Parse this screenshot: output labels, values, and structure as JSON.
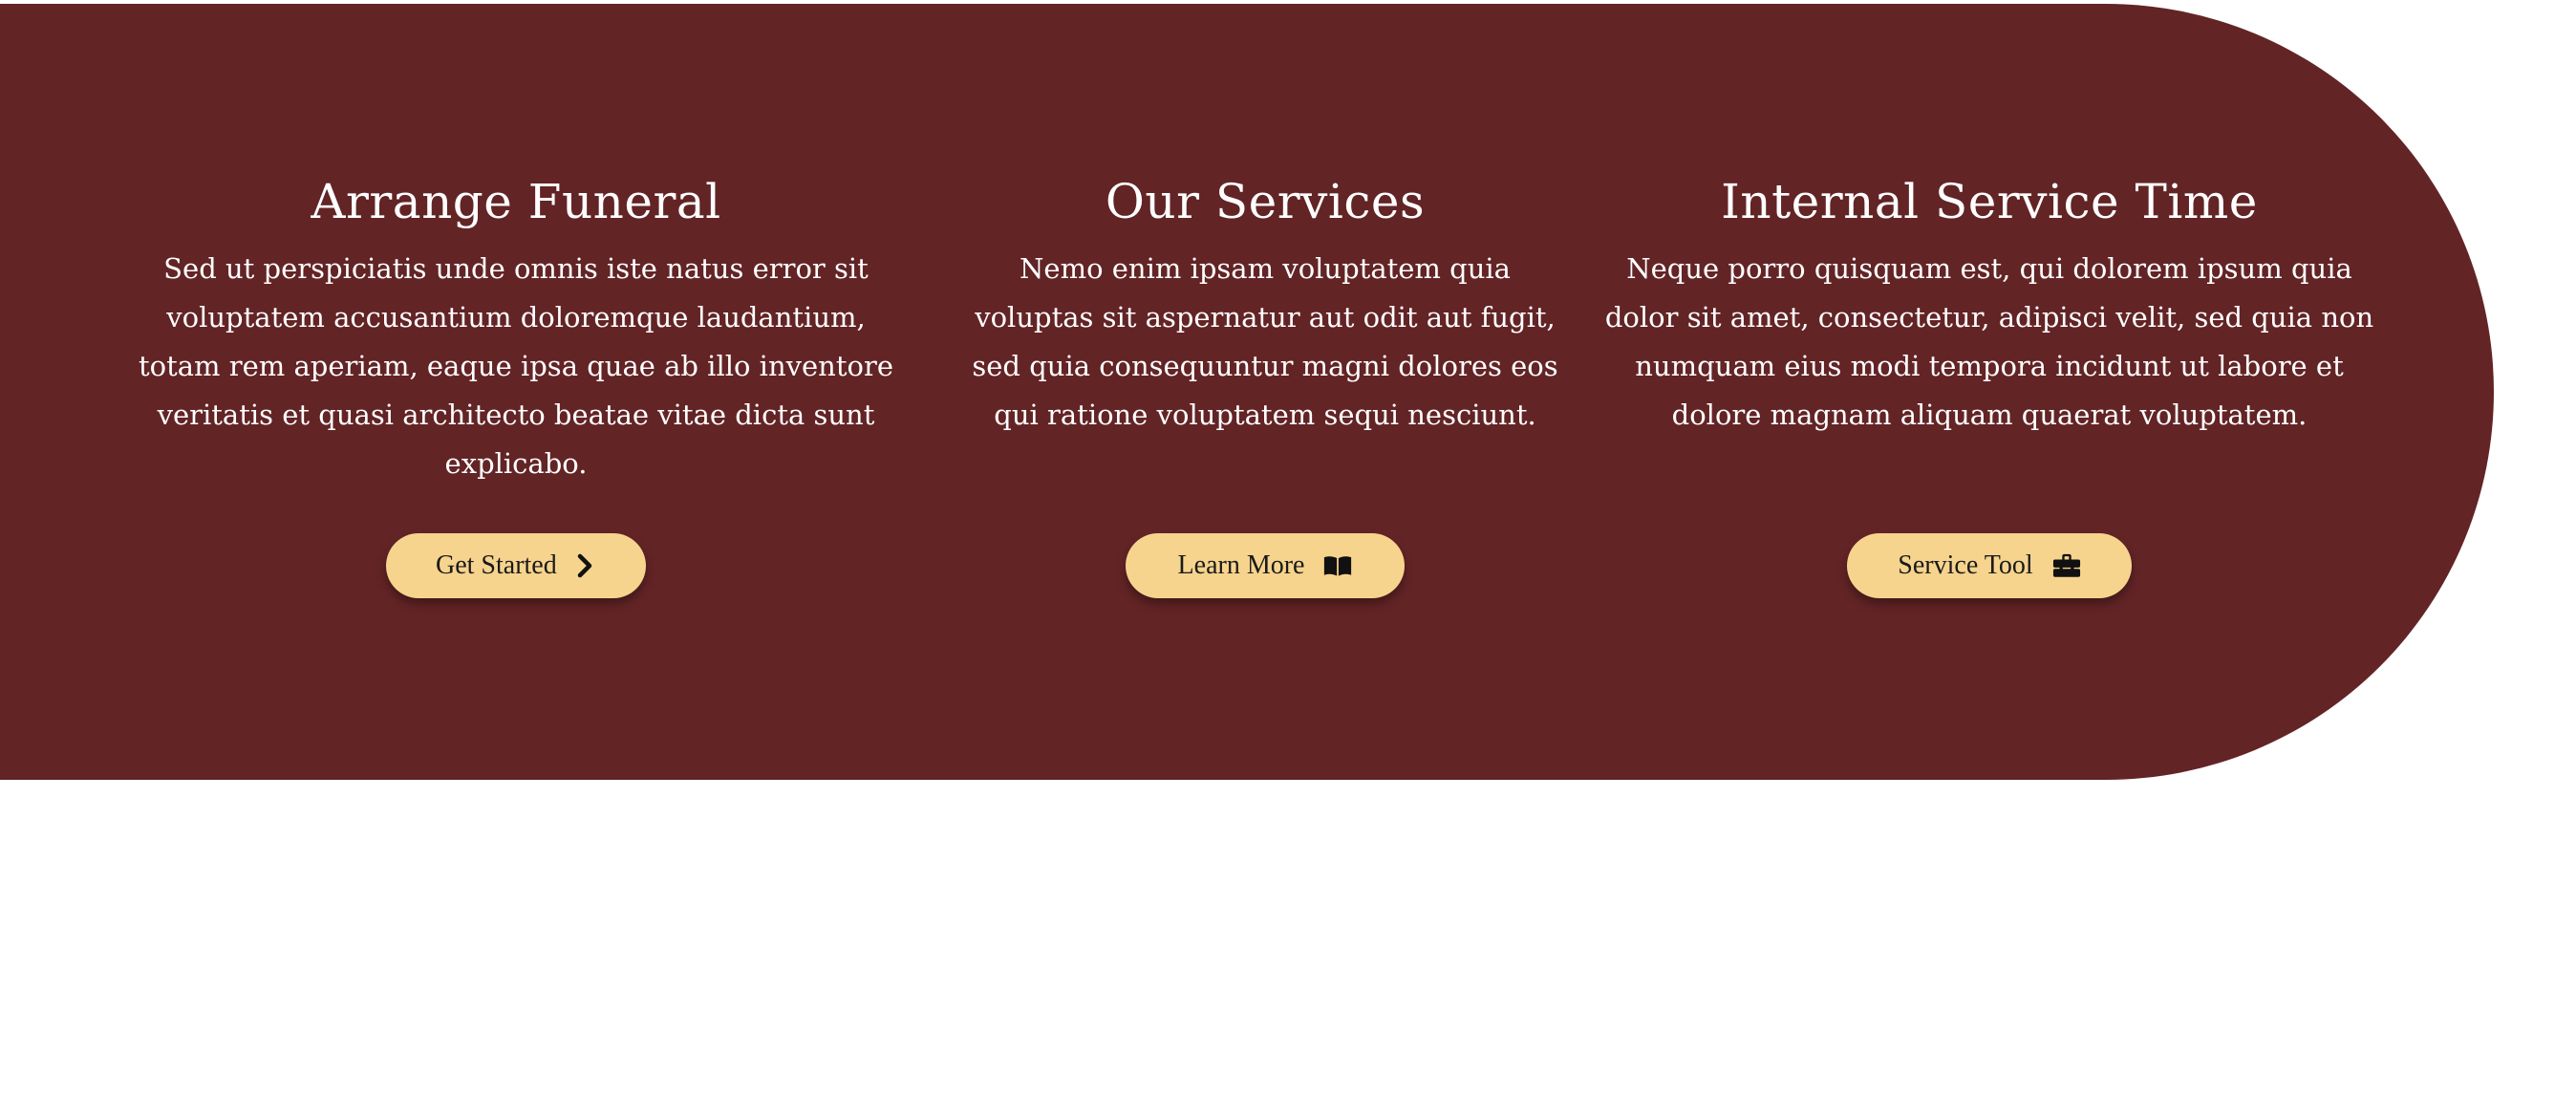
{
  "sections": [
    {
      "title": "Arrange Funeral",
      "description": "Sed ut perspiciatis unde omnis iste natus error sit voluptatem accusantium doloremque laudantium, totam rem aperiam, eaque ipsa quae ab illo inventore veritatis et quasi architecto beatae vitae dicta sunt explicabo.",
      "button": {
        "label": "Get Started",
        "icon": "chevron-right-icon"
      }
    },
    {
      "title": "Our Services",
      "description": "Nemo enim ipsam voluptatem quia voluptas sit aspernatur aut odit aut fugit, sed quia consequuntur magni dolores eos qui ratione voluptatem sequi nesciunt.",
      "button": {
        "label": "Learn More",
        "icon": "book-open-icon"
      }
    },
    {
      "title": "Internal Service Time",
      "description": "Neque porro quisquam est, qui dolorem ipsum quia dolor sit amet, consectetur, adipisci velit, sed quia non numquam eius modi tempora incidunt ut labore et dolore magnam aliquam quaerat voluptatem.",
      "button": {
        "label": "Service Tool",
        "icon": "toolbox-icon"
      }
    }
  ],
  "colors": {
    "banner_background": "#632426",
    "button_background": "#f7d48d",
    "text_on_banner": "#ffffff",
    "button_text": "#1a1a1a",
    "page_background": "#ffffff"
  }
}
